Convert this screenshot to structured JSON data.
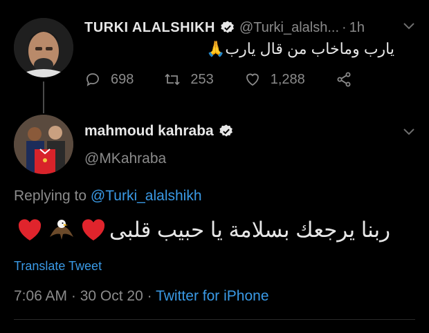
{
  "parent_tweet": {
    "name": "TURKI ALALSHIKH",
    "handle": "@Turki_alalsh...",
    "separator": "·",
    "time": "1h",
    "text": "يارب وماخاب من قال يارب🙏",
    "replies": "698",
    "retweets": "253",
    "likes": "1,288",
    "icons": [
      "verified-badge-icon",
      "reply-icon",
      "retweet-icon",
      "like-icon",
      "share-icon",
      "chevron-down-icon"
    ]
  },
  "reply_tweet": {
    "name": "mahmoud kahraba",
    "handle": "@MKahraba",
    "replying_prefix": "Replying to ",
    "replying_to": "@Turki_alalshikh",
    "text": "ربنا يرجعك بسلامة يا حبيب قلبى",
    "emojis": [
      "heart",
      "eagle",
      "heart"
    ],
    "translate": "Translate Tweet",
    "time": "7:06 AM",
    "date": "30 Oct 20",
    "meta_sep": " · ",
    "source": "Twitter for iPhone"
  },
  "colors": {
    "background": "#000000",
    "link": "#3a9ae6",
    "muted": "#8b8b8b",
    "text": "#e7e7e7"
  }
}
